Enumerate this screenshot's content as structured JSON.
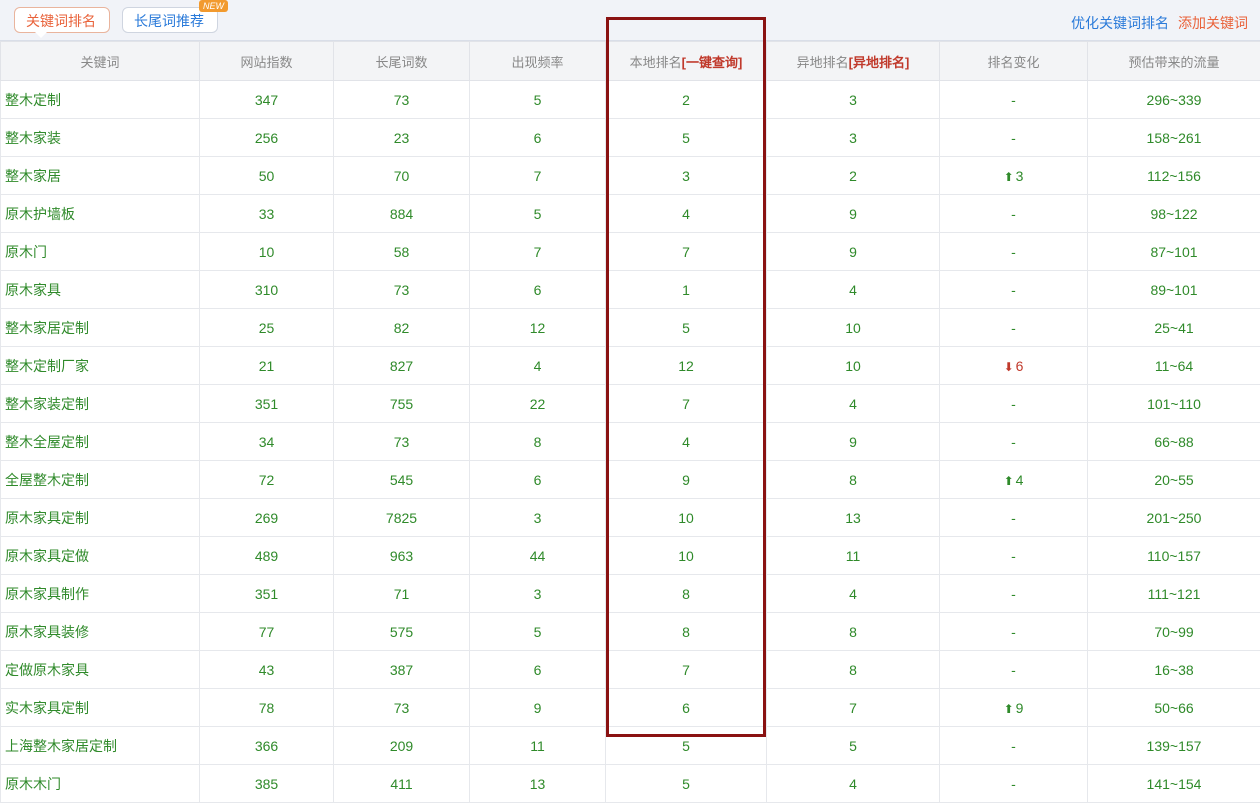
{
  "tabs": {
    "keyword_rank": "关键词排名",
    "longtail": "长尾词推荐",
    "new_badge": "NEW"
  },
  "links": {
    "optimize": "优化关键词排名",
    "add": "添加关键词"
  },
  "colors": {
    "accent_orange": "#e9623a",
    "link_blue": "#2a7ad9",
    "value_green": "#2f8a2a",
    "down_red": "#c0392b",
    "highlight_border": "#8a1212"
  },
  "table": {
    "headers": {
      "keyword": "关键词",
      "site_index": "网站指数",
      "longtail_count": "长尾词数",
      "frequency": "出现频率",
      "local_rank": "本地排名",
      "local_rank_link": "[一键查询]",
      "remote_rank": "异地排名",
      "remote_rank_link": "[异地排名]",
      "rank_change": "排名变化",
      "traffic": "预估带来的流量"
    },
    "rows": [
      {
        "keyword": "整木定制",
        "index": "347",
        "longtail": "73",
        "freq": "5",
        "local": "2",
        "remote": "3",
        "change": "-",
        "dir": "",
        "traffic": "296~339"
      },
      {
        "keyword": "整木家装",
        "index": "256",
        "longtail": "23",
        "freq": "6",
        "local": "5",
        "remote": "3",
        "change": "-",
        "dir": "",
        "traffic": "158~261"
      },
      {
        "keyword": "整木家居",
        "index": "50",
        "longtail": "70",
        "freq": "7",
        "local": "3",
        "remote": "2",
        "change": "3",
        "dir": "up",
        "traffic": "112~156"
      },
      {
        "keyword": "原木护墙板",
        "index": "33",
        "longtail": "884",
        "freq": "5",
        "local": "4",
        "remote": "9",
        "change": "-",
        "dir": "",
        "traffic": "98~122"
      },
      {
        "keyword": "原木门",
        "index": "10",
        "longtail": "58",
        "freq": "7",
        "local": "7",
        "remote": "9",
        "change": "-",
        "dir": "",
        "traffic": "87~101"
      },
      {
        "keyword": "原木家具",
        "index": "310",
        "longtail": "73",
        "freq": "6",
        "local": "1",
        "remote": "4",
        "change": "-",
        "dir": "",
        "traffic": "89~101"
      },
      {
        "keyword": "整木家居定制",
        "index": "25",
        "longtail": "82",
        "freq": "12",
        "local": "5",
        "remote": "10",
        "change": "-",
        "dir": "",
        "traffic": "25~41"
      },
      {
        "keyword": "整木定制厂家",
        "index": "21",
        "longtail": "827",
        "freq": "4",
        "local": "12",
        "remote": "10",
        "change": "6",
        "dir": "down",
        "traffic": "11~64"
      },
      {
        "keyword": "整木家装定制",
        "index": "351",
        "longtail": "755",
        "freq": "22",
        "local": "7",
        "remote": "4",
        "change": "-",
        "dir": "",
        "traffic": "101~110"
      },
      {
        "keyword": "整木全屋定制",
        "index": "34",
        "longtail": "73",
        "freq": "8",
        "local": "4",
        "remote": "9",
        "change": "-",
        "dir": "",
        "traffic": "66~88"
      },
      {
        "keyword": "全屋整木定制",
        "index": "72",
        "longtail": "545",
        "freq": "6",
        "local": "9",
        "remote": "8",
        "change": "4",
        "dir": "up",
        "traffic": "20~55"
      },
      {
        "keyword": "原木家具定制",
        "index": "269",
        "longtail": "7825",
        "freq": "3",
        "local": "10",
        "remote": "13",
        "change": "-",
        "dir": "",
        "traffic": "201~250"
      },
      {
        "keyword": "原木家具定做",
        "index": "489",
        "longtail": "963",
        "freq": "44",
        "local": "10",
        "remote": "11",
        "change": "-",
        "dir": "",
        "traffic": "110~157"
      },
      {
        "keyword": "原木家具制作",
        "index": "351",
        "longtail": "71",
        "freq": "3",
        "local": "8",
        "remote": "4",
        "change": "-",
        "dir": "",
        "traffic": "111~121"
      },
      {
        "keyword": "原木家具装修",
        "index": "77",
        "longtail": "575",
        "freq": "5",
        "local": "8",
        "remote": "8",
        "change": "-",
        "dir": "",
        "traffic": "70~99"
      },
      {
        "keyword": "定做原木家具",
        "index": "43",
        "longtail": "387",
        "freq": "6",
        "local": "7",
        "remote": "8",
        "change": "-",
        "dir": "",
        "traffic": "16~38"
      },
      {
        "keyword": "实木家具定制",
        "index": "78",
        "longtail": "73",
        "freq": "9",
        "local": "6",
        "remote": "7",
        "change": "9",
        "dir": "up",
        "traffic": "50~66"
      },
      {
        "keyword": "上海整木家居定制",
        "index": "366",
        "longtail": "209",
        "freq": "11",
        "local": "5",
        "remote": "5",
        "change": "-",
        "dir": "",
        "traffic": "139~157"
      },
      {
        "keyword": "原木木门",
        "index": "385",
        "longtail": "411",
        "freq": "13",
        "local": "5",
        "remote": "4",
        "change": "-",
        "dir": "",
        "traffic": "141~154"
      }
    ]
  }
}
